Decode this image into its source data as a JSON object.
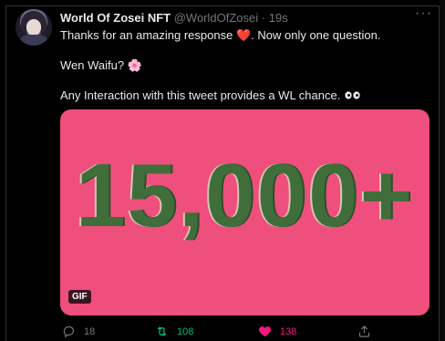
{
  "tweet": {
    "author_name": "World Of Zosei NFT",
    "handle": "@WorldOfZosei",
    "separator": "·",
    "time": "19s",
    "more_label": "···",
    "text_line1_a": "Thanks for an amazing response",
    "heart_emoji": "❤️",
    "text_line1_b": ". Now only one question.",
    "text_line2": "Wen Waifu?",
    "sakura_emoji": "🌸",
    "text_line3": "Any Interaction with this tweet provides a WL chance.",
    "media_text": "15,000+",
    "gif_label": "GIF"
  },
  "actions": {
    "reply_count": "18",
    "retweet_count": "108",
    "like_count": "138"
  },
  "colors": {
    "background": "#000000",
    "media_bg": "#ee4f7c",
    "retweet": "#00ba7c",
    "like": "#f91880",
    "muted": "#71767b"
  },
  "icons": [
    "reply-icon",
    "retweet-icon",
    "like-icon",
    "share-icon",
    "more-icon"
  ]
}
